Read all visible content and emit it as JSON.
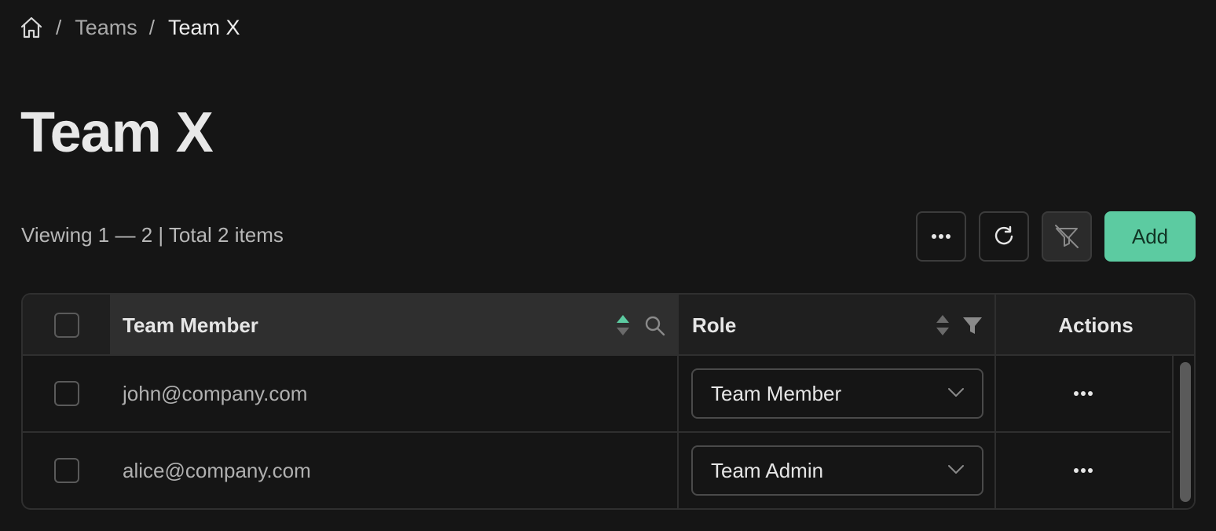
{
  "breadcrumb": {
    "home_icon": "home-icon",
    "separator": "/",
    "items": [
      "Teams",
      "Team X"
    ]
  },
  "title": "Team X",
  "toolbar": {
    "viewing_text": "Viewing 1 — 2 | Total 2 items",
    "more_icon": "more-horizontal-icon",
    "refresh_icon": "refresh-icon",
    "clear_filter_icon": "filter-off-icon",
    "add_label": "Add"
  },
  "table": {
    "columns": {
      "member": "Team Member",
      "role": "Role",
      "actions": "Actions"
    },
    "rows": [
      {
        "email": "john@company.com",
        "role": "Team Member"
      },
      {
        "email": "alice@company.com",
        "role": "Team Admin"
      }
    ]
  },
  "colors": {
    "background": "#151515",
    "accent": "#5ccba1",
    "border": "#2f2f2f"
  }
}
